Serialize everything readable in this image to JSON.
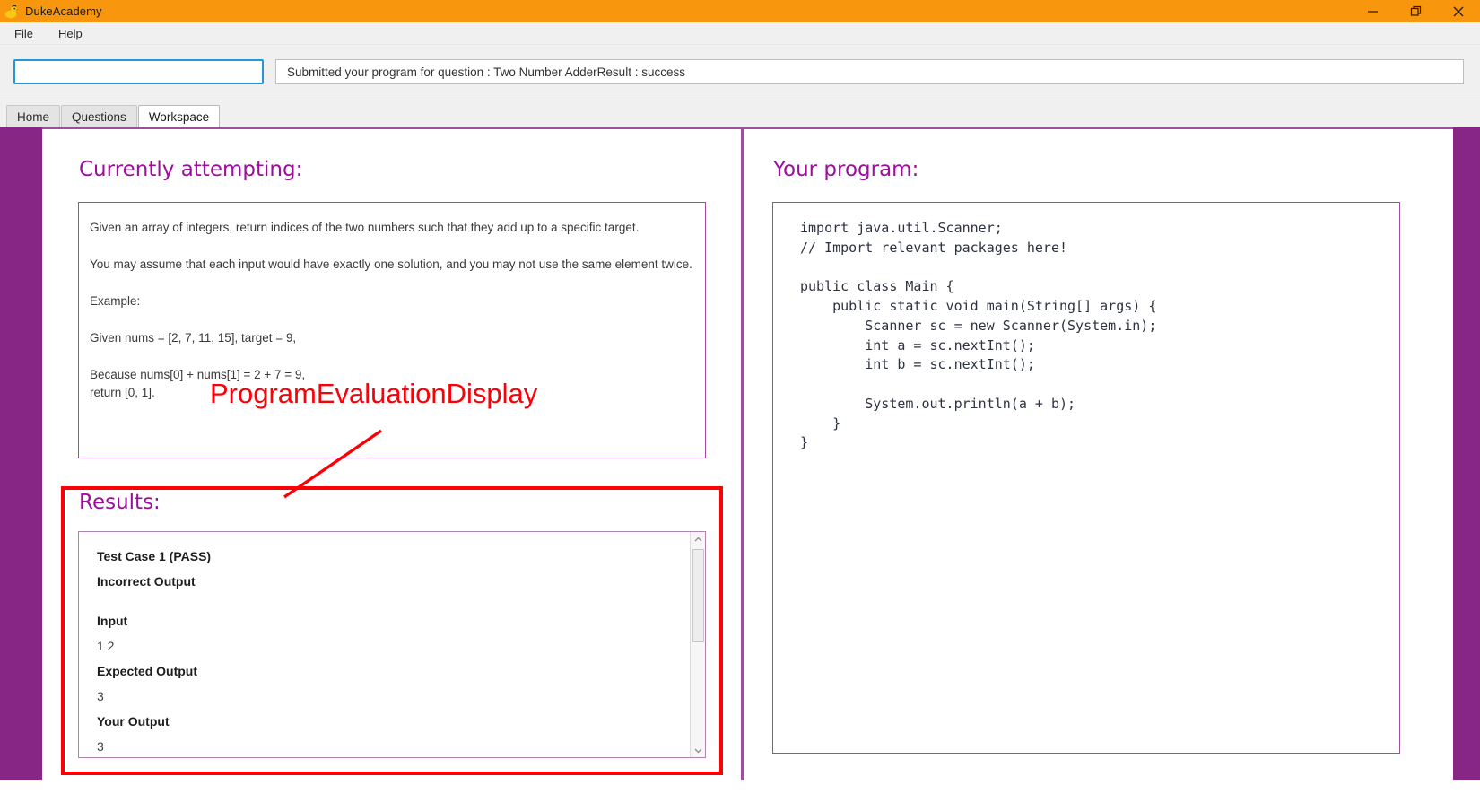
{
  "window": {
    "title": "DukeAcademy",
    "app_icon": "duck-icon",
    "controls": [
      {
        "name": "minimize",
        "glyph": "minimize-icon"
      },
      {
        "name": "restore",
        "glyph": "restore-icon"
      },
      {
        "name": "close",
        "glyph": "close-icon"
      }
    ]
  },
  "menubar": {
    "items": [
      {
        "label": "File"
      },
      {
        "label": "Help"
      }
    ]
  },
  "toolbar": {
    "command_input": {
      "value": "",
      "placeholder": ""
    },
    "status": {
      "text": "Submitted your program for question : Two Number AdderResult : success"
    }
  },
  "tabs": [
    {
      "label": "Home",
      "active": false
    },
    {
      "label": "Questions",
      "active": false
    },
    {
      "label": "Workspace",
      "active": true
    }
  ],
  "left_panel": {
    "heading": "Currently attempting:",
    "question_lines": [
      "Given an array of integers, return indices of the two numbers such that they add up to a specific target.",
      "You may assume that each input would have exactly one solution, and you may not use the same element twice.",
      "Example:",
      "Given nums = [2, 7, 11, 15], target = 9,",
      "Because nums[0] + nums[1] = 2 + 7 = 9,",
      "return [0, 1]."
    ],
    "results_heading": "Results:",
    "results": {
      "test_case_title": "Test Case 1   (PASS)",
      "verdict": "Incorrect Output",
      "input_label": "Input",
      "input_value": "1 2",
      "expected_label": "Expected Output",
      "expected_value": "3",
      "your_label": "Your Output",
      "your_value": "3"
    }
  },
  "right_panel": {
    "heading": "Your program:",
    "code": "import java.util.Scanner;\n// Import relevant packages here!\n\npublic class Main {\n    public static void main(String[] args) {\n        Scanner sc = new Scanner(System.in);\n        int a = sc.nextInt();\n        int b = sc.nextInt();\n\n        System.out.println(a + b);\n    }\n}"
  },
  "annotation": {
    "label": "ProgramEvaluationDisplay",
    "color": "#fb0007"
  },
  "colors": {
    "titlebar": "#f8960d",
    "accent_purple": "#872684",
    "heading_purple": "#9d0e9d",
    "border_purple": "#9c4f9c",
    "focus_blue": "#2596d9",
    "annotation_red": "#fb0007"
  }
}
